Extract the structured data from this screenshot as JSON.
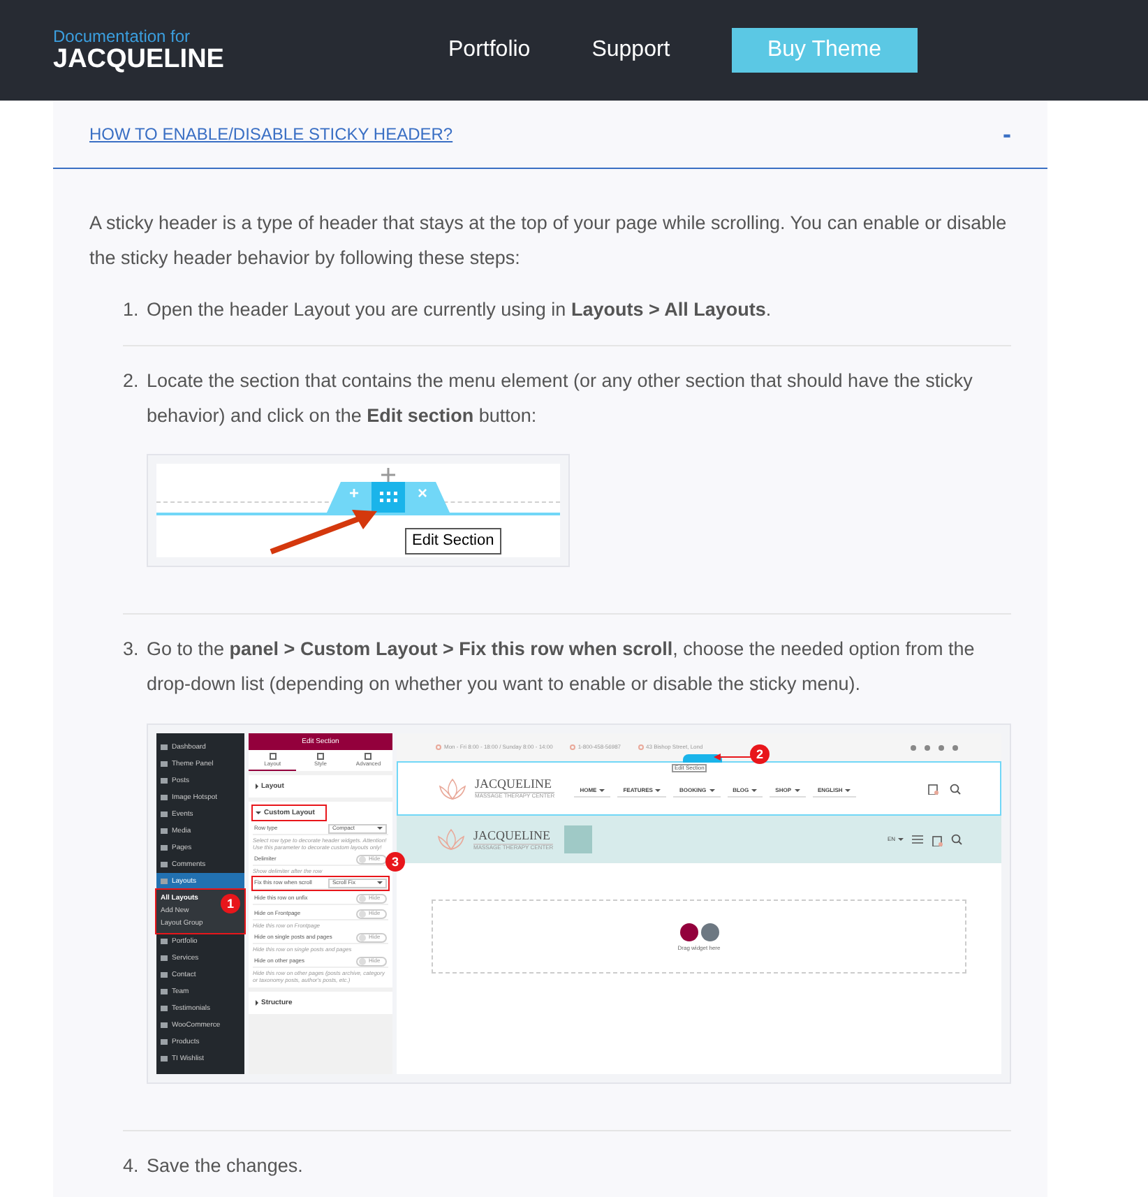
{
  "header": {
    "logo_caption": "Documentation for",
    "logo_title": "JACQUELINE",
    "nav": [
      {
        "label": "Portfolio",
        "kind": "link"
      },
      {
        "label": "Support",
        "kind": "link"
      },
      {
        "label": "Buy Theme",
        "kind": "button"
      }
    ]
  },
  "accordion": {
    "title": "HOW TO ENABLE/DISABLE STICKY HEADER?",
    "expanded": true,
    "toggle": "-"
  },
  "intro": "A sticky header is a type of header that stays at the top of your page while scrolling. You can enable or disable the sticky header behavior by following these steps:",
  "steps": [
    {
      "number": "1.",
      "text": "Open the header Layout you are currently using in **Layouts > All Layouts**."
    },
    {
      "number": "2.",
      "text": "Locate the section that contains the menu element (or any other section that should have the sticky behavior) and click on the **Edit section** button:",
      "figure": {
        "kind": "edit_handle",
        "add": "+",
        "remove": "×",
        "tooltip": "Edit Section"
      }
    },
    {
      "number": "3.",
      "text": "Go to the **panel > Custom Layout > Fix this row when scroll**, choose the needed option from the drop-down list (depending on whether you want to enable or disable the sticky menu).",
      "figure": {
        "kind": "editor",
        "sidebar": [
          {
            "label": "Dashboard",
            "selected": false
          },
          {
            "label": "Theme Panel",
            "selected": false
          },
          {
            "label": "Posts",
            "selected": false
          },
          {
            "label": "Image Hotspot",
            "selected": false
          },
          {
            "label": "Events",
            "selected": false
          },
          {
            "label": "Media",
            "selected": false
          },
          {
            "label": "Pages",
            "selected": false
          },
          {
            "label": "Comments",
            "selected": false
          },
          {
            "label": "Layouts",
            "selected": true,
            "callout": "1",
            "children": [
              {
                "label": "All Layouts",
                "selected": true
              },
              {
                "label": "Add New",
                "selected": false
              },
              {
                "label": "Layout Group",
                "selected": false
              }
            ]
          },
          {
            "label": "Portfolio",
            "selected": false
          },
          {
            "label": "Services",
            "selected": false
          },
          {
            "label": "Contact",
            "selected": false
          },
          {
            "label": "Team",
            "selected": false
          },
          {
            "label": "Testimonials",
            "selected": false
          },
          {
            "label": "WooCommerce",
            "selected": false
          },
          {
            "label": "Products",
            "selected": false
          },
          {
            "label": "TI Wishlist",
            "selected": false
          }
        ],
        "panel": {
          "title": "Edit Section",
          "tabs": [
            {
              "label": "Layout",
              "selected": true
            },
            {
              "label": "Style",
              "selected": false
            },
            {
              "label": "Advanced",
              "selected": false
            }
          ],
          "sections": [
            {
              "title": "Layout",
              "expanded": false,
              "highlighted": false
            },
            {
              "title": "Custom Layout",
              "expanded": true,
              "highlighted": true,
              "fields": [
                {
                  "kind": "select",
                  "label": "Row type",
                  "value": "Compact",
                  "highlighted": false,
                  "hint": "Select row type to decorate header widgets. Attention! Use this parameter to decorate custom layouts only!"
                },
                {
                  "kind": "toggle",
                  "label": "Delimiter",
                  "on": false,
                  "highlighted": false,
                  "toggle_label": "Hide",
                  "hint": "Show delimiter after the row"
                },
                {
                  "kind": "select",
                  "label": "Fix this row when scroll",
                  "value": "Scroll Fix",
                  "highlighted": true,
                  "callout": "3"
                },
                {
                  "kind": "toggle",
                  "label": "Hide this row on unfix",
                  "on": false,
                  "highlighted": false,
                  "toggle_label": "Hide"
                },
                {
                  "kind": "toggle",
                  "label": "Hide on Frontpage",
                  "on": false,
                  "highlighted": false,
                  "toggle_label": "Hide",
                  "hint": "Hide this row on Frontpage"
                },
                {
                  "kind": "toggle",
                  "label": "Hide on single posts and pages",
                  "on": false,
                  "highlighted": false,
                  "toggle_label": "Hide",
                  "hint": "Hide this row on single posts and pages"
                },
                {
                  "kind": "toggle",
                  "label": "Hide on other pages",
                  "on": false,
                  "highlighted": false,
                  "toggle_label": "Hide",
                  "hint": "Hide this row on other pages (posts archive, category or taxonomy posts, author's posts, etc.)"
                }
              ]
            },
            {
              "title": "Structure",
              "expanded": false,
              "highlighted": false
            }
          ]
        },
        "site": {
          "topbar": [
            "Mon - Fri 8:00 - 18:00 / Sunday 8:00 - 14:00",
            "1-800-458-56987",
            "43 Bishop Street, Lond"
          ],
          "handle_callout": "2",
          "handle_tooltip": "Edit Section",
          "logo": "JACQUELINE",
          "tagline": "MASSAGE THERAPY CENTER",
          "menu": [
            "HOME",
            "FEATURES",
            "BOOKING",
            "BLOG",
            "SHOP",
            "ENGLISH"
          ],
          "sticky_logo": "JACQUELINE",
          "sticky_tagline": "MASSAGE THERAPY CENTER",
          "sticky_lang": "EN",
          "empty_hint": "Drag widget here"
        }
      }
    },
    {
      "number": "4.",
      "text": "Save the changes."
    }
  ]
}
